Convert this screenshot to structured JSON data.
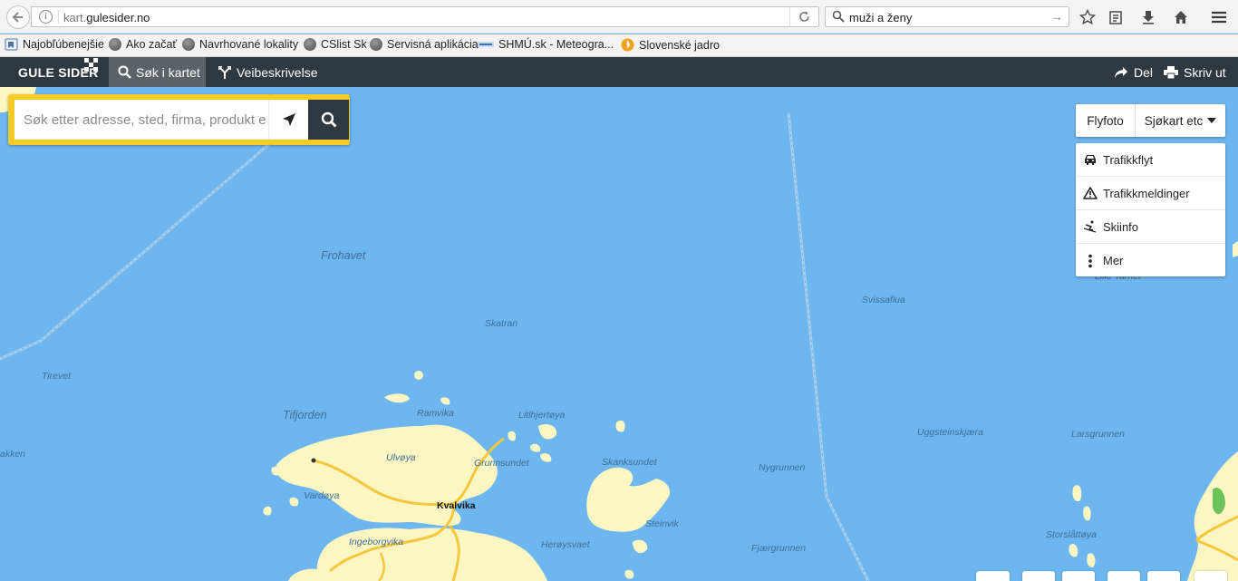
{
  "browser": {
    "url_prefix": "kart.",
    "url_domain": "gulesider.no",
    "search_value": "muži a ženy",
    "bookmarks": [
      {
        "label": "Najobľúbenejšie"
      },
      {
        "label": "Ako začať"
      },
      {
        "label": "Navrhované lokality"
      },
      {
        "label": "CSlist Sk"
      },
      {
        "label": "Servisná aplikácia"
      },
      {
        "label": "SHMÚ.sk - Meteogra..."
      },
      {
        "label": "Slovenské jadro"
      }
    ]
  },
  "app": {
    "logo": "GULE SIDER",
    "tabs": [
      {
        "label": "Søk i kartet"
      },
      {
        "label": "Veibeskrivelse"
      }
    ],
    "share_label": "Del",
    "print_label": "Skriv ut"
  },
  "search": {
    "placeholder": "Søk etter adresse, sted, firma, produkt e"
  },
  "layers": {
    "flyfoto_label": "Flyfoto",
    "sjokart_label": "Sjøkart etc"
  },
  "menu": {
    "items": [
      {
        "label": "Trafikkflyt",
        "icon": "car-icon"
      },
      {
        "label": "Trafikkmeldinger",
        "icon": "warning-icon"
      },
      {
        "label": "Skiinfo",
        "icon": "skier-icon"
      },
      {
        "label": "Mer",
        "icon": "more-icon"
      }
    ]
  },
  "map": {
    "places": [
      "Frohavet",
      "Skatran",
      "Svissaflua",
      "Tirevet",
      "Tifjorden",
      "Ramvika",
      "Litlhjertøya",
      "Ulvøya",
      "Grunnsundet",
      "Skanksundet",
      "Vardøya",
      "Steinvik",
      "Ingeborgvika",
      "Herøysvaet",
      "Nygrunnen",
      "Fjærgrunnen",
      "Uggsteinskjæra",
      "Larsgrunnen",
      "Storslåttøya",
      "akken",
      "Lille Tarnet"
    ],
    "town": "Kvalvika",
    "colors": {
      "sea": "#6db6ef",
      "land": "#fcf7c2",
      "road": "#f3c73e"
    }
  }
}
